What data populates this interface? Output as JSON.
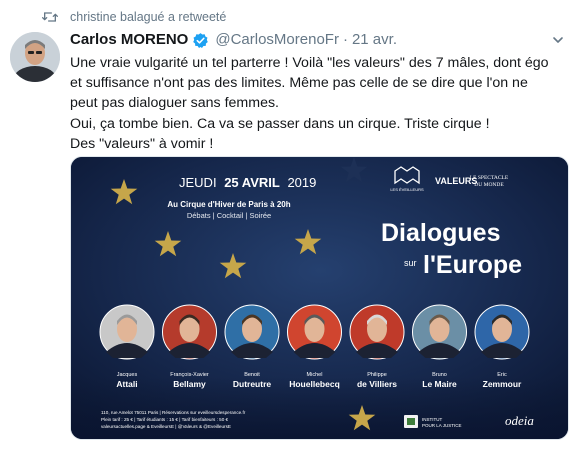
{
  "retweet": {
    "text": "christine balagué a retweeté"
  },
  "tweet": {
    "author_name": "Carlos MORENO",
    "handle": "@CarlosMorenoFr",
    "separator": "·",
    "time": "21 avr.",
    "lines": [
      "Une vraie vulgarité un tel parterre ! Voilà \"les valeurs\" des 7 mâles, dont égo",
      "et suffisance n'ont pas des limites. Même pas celle de se dire que l'on ne",
      "peut pas dialoguer sans femmes.",
      "Oui, ça tombe bien. Ca va se passer dans un cirque. Triste cirque !",
      "Des \"valeurs\" à vomir !"
    ]
  },
  "poster": {
    "date_prefix": "JEUDI",
    "date_main": "25 AVRIL",
    "date_year": "2019",
    "venue": "Au Cirque d'Hiver de Paris à 20h",
    "program": "Débats | Cocktail | Soirée",
    "logo_eveilleurs": "LES ÉVEILLEURS",
    "logo_valeurs": "VALEURS",
    "logo_spectacle_1": "LE SPECTACLE",
    "logo_spectacle_2": "DU MONDE",
    "title_1": "Dialogues",
    "title_sur": "sur",
    "title_2": "l'Europe",
    "speakers": [
      {
        "first": "Jacques",
        "last": "Attali"
      },
      {
        "first": "François-Xavier",
        "last": "Bellamy"
      },
      {
        "first": "Benoit",
        "last": "Dutreutre"
      },
      {
        "first": "Michel",
        "last": "Houellebecq"
      },
      {
        "first": "Philippe",
        "last": "de Villiers"
      },
      {
        "first": "Bruno",
        "last": "Le Maire"
      },
      {
        "first": "Eric",
        "last": "Zemmour"
      }
    ],
    "footer_1": "110, rue Amelot 75011 Paris | Réservations sur eveilleursdesperance.fr",
    "footer_2": "Plein tarif : 25 € | Tarif étudiants : 15 € | Tarif bienfaiteurs : 50 €",
    "footer_3": "valeursactuelles.page & EveilleursE | @Valeurs & @EveilleursE",
    "logo_institut_1": "INSTITUT",
    "logo_institut_2": "POUR LA JUSTICE",
    "logo_odeia": "odeia"
  },
  "colors": {
    "poster_bg": "#15264a",
    "star": "#c6a64a",
    "verified": "#1da1f2",
    "muted": "#657786"
  }
}
